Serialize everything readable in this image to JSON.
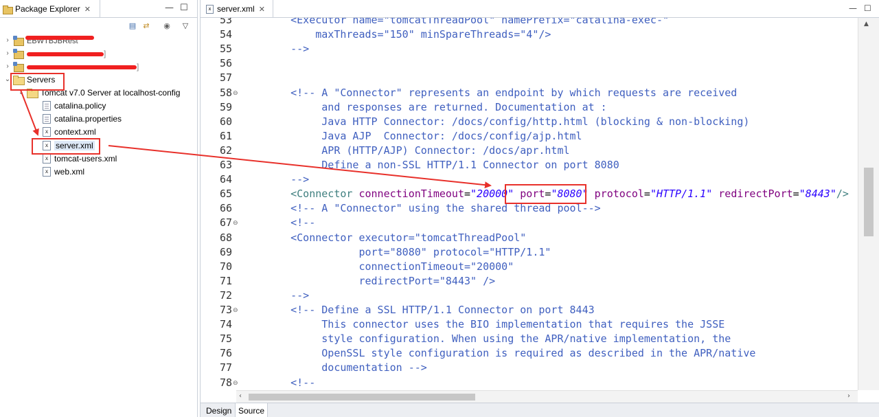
{
  "package_explorer": {
    "tab_title": "Package Explorer",
    "close_glyph": "✕",
    "minimize_glyph": "—",
    "maximize_glyph": "☐",
    "menu_glyph": "▽"
  },
  "tree": {
    "project1_label": "EBWTBJBRest",
    "project2_label": "",
    "project2_suffix": "]",
    "project3_label": "",
    "project3_suffix": "]",
    "servers_label": "Servers",
    "tomcat_label": "Tomcat v7.0 Server at localhost-config",
    "files": [
      "catalina.policy",
      "catalina.properties",
      "context.xml",
      "server.xml",
      "tomcat-users.xml",
      "web.xml"
    ]
  },
  "editor": {
    "tab_title": "server.xml",
    "close_glyph": "✕",
    "bottom_tabs": [
      "Design",
      "Source"
    ],
    "active_bottom_tab": "Source",
    "lines": [
      {
        "n": "53",
        "fold": false,
        "text": "    <Executor name=\"tomcatThreadPool\" namePrefix=\"catalina-exec-\""
      },
      {
        "n": "54",
        "fold": false,
        "text": "        maxThreads=\"150\" minSpareThreads=\"4\"/>"
      },
      {
        "n": "55",
        "fold": false,
        "text": "    -->"
      },
      {
        "n": "56",
        "fold": false,
        "text": ""
      },
      {
        "n": "57",
        "fold": false,
        "text": ""
      },
      {
        "n": "58",
        "fold": true,
        "text": "    <!-- A \"Connector\" represents an endpoint by which requests are received"
      },
      {
        "n": "59",
        "fold": false,
        "text": "         and responses are returned. Documentation at :"
      },
      {
        "n": "60",
        "fold": false,
        "text": "         Java HTTP Connector: /docs/config/http.html (blocking & non-blocking)"
      },
      {
        "n": "61",
        "fold": false,
        "text": "         Java AJP  Connector: /docs/config/ajp.html"
      },
      {
        "n": "62",
        "fold": false,
        "text": "         APR (HTTP/AJP) Connector: /docs/apr.html"
      },
      {
        "n": "63",
        "fold": false,
        "text": "         Define a non-SSL HTTP/1.1 Connector on port 8080"
      },
      {
        "n": "64",
        "fold": false,
        "text": "    -->"
      },
      {
        "n": "65",
        "fold": false,
        "text": "    <Connector connectionTimeout=\"20000\" port=\"8080\" protocol=\"HTTP/1.1\" redirectPort=\"8443\"/>"
      },
      {
        "n": "66",
        "fold": false,
        "text": "    <!-- A \"Connector\" using the shared thread pool-->"
      },
      {
        "n": "67",
        "fold": true,
        "text": "    <!--"
      },
      {
        "n": "68",
        "fold": false,
        "text": "    <Connector executor=\"tomcatThreadPool\""
      },
      {
        "n": "69",
        "fold": false,
        "text": "               port=\"8080\" protocol=\"HTTP/1.1\""
      },
      {
        "n": "70",
        "fold": false,
        "text": "               connectionTimeout=\"20000\""
      },
      {
        "n": "71",
        "fold": false,
        "text": "               redirectPort=\"8443\" />"
      },
      {
        "n": "72",
        "fold": false,
        "text": "    -->"
      },
      {
        "n": "73",
        "fold": true,
        "text": "    <!-- Define a SSL HTTP/1.1 Connector on port 8443"
      },
      {
        "n": "74",
        "fold": false,
        "text": "         This connector uses the BIO implementation that requires the JSSE"
      },
      {
        "n": "75",
        "fold": false,
        "text": "         style configuration. When using the APR/native implementation, the"
      },
      {
        "n": "76",
        "fold": false,
        "text": "         OpenSSL style configuration is required as described in the APR/native"
      },
      {
        "n": "77",
        "fold": false,
        "text": "         documentation -->"
      },
      {
        "n": "78",
        "fold": true,
        "text": "    <!--"
      }
    ],
    "connector_line": {
      "tag_open": "<Connector",
      "a1": "connectionTimeout",
      "v1": "\"20000\"",
      "a2": "port",
      "v2": "\"8080\"",
      "a3": "protocol",
      "v3": "\"HTTP/1.1\"",
      "a4": "redirectPort",
      "v4": "\"8443\"",
      "tail": "/>"
    }
  },
  "colors": {
    "annotation_red": "#e8302a",
    "comment_blue": "#3f5fbf",
    "tag_teal": "#3f7f7f",
    "attr_purple": "#7f007f",
    "value_blue": "#2a00ff"
  }
}
